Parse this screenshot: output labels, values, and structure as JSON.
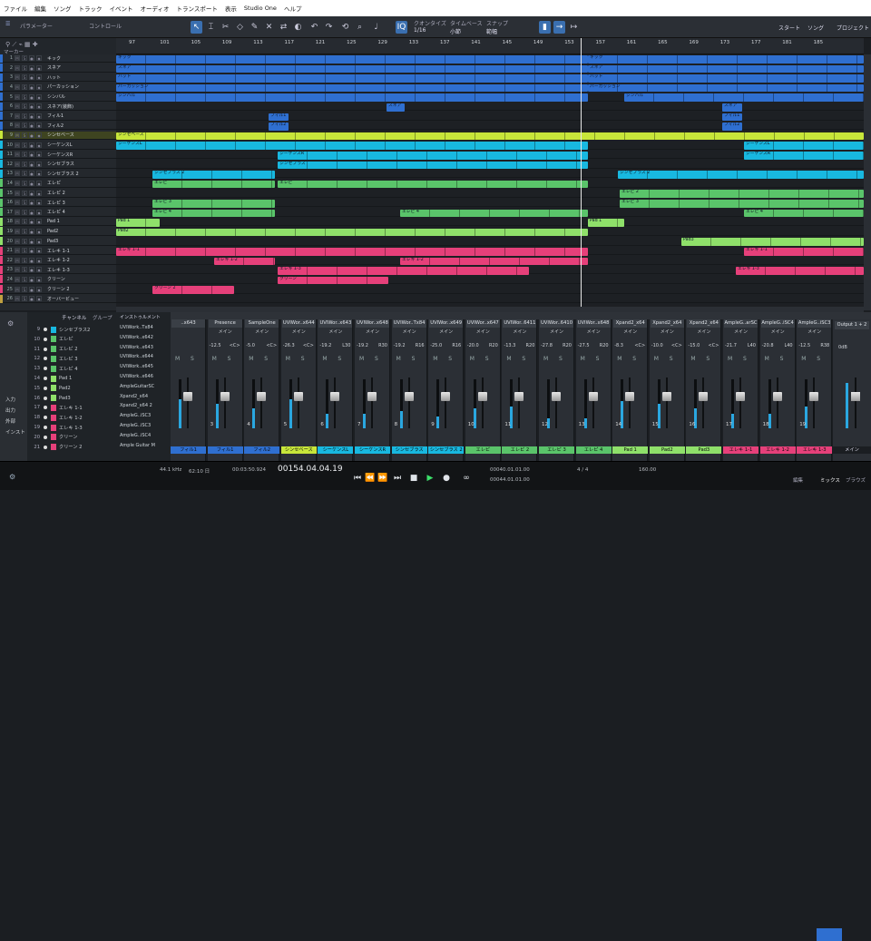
{
  "menu": [
    "ファイル",
    "編集",
    "ソング",
    "トラック",
    "イベント",
    "オーディオ",
    "トランスポート",
    "表示",
    "Studio One",
    "ヘルプ"
  ],
  "toolbar": {
    "param_label": "パラメーター",
    "control_label": "コントロール",
    "quantize_label": "クオンタイズ",
    "quantize_value": "1/16",
    "timebase_label": "タイムベース",
    "timebase_value": "小節",
    "snap_label": "スナップ",
    "snap_value": "範幅",
    "start_label": "スタート",
    "song_label": "ソング",
    "project_label": "プロジェクト"
  },
  "ruler": {
    "bars": [
      "97",
      "101",
      "105",
      "109",
      "113",
      "117",
      "121",
      "125",
      "129",
      "133",
      "137",
      "141",
      "145",
      "149",
      "153",
      "157",
      "161",
      "165",
      "169",
      "173",
      "177",
      "181",
      "185"
    ]
  },
  "marker_label": "マーカー",
  "tracks": [
    {
      "n": "1",
      "name": "キック",
      "color": "#2f6fd0"
    },
    {
      "n": "2",
      "name": "スネア",
      "color": "#2f6fd0"
    },
    {
      "n": "3",
      "name": "ハット",
      "color": "#2f6fd0"
    },
    {
      "n": "4",
      "name": "パーカッション",
      "color": "#2f6fd0"
    },
    {
      "n": "5",
      "name": "シンバル",
      "color": "#2f6fd0"
    },
    {
      "n": "6",
      "name": "スネア(装飾)",
      "color": "#2f6fd0"
    },
    {
      "n": "7",
      "name": "フィル1",
      "color": "#2f6fd0"
    },
    {
      "n": "8",
      "name": "フィル2",
      "color": "#2f6fd0"
    },
    {
      "n": "9",
      "name": "シンセベース",
      "color": "#c8e63a"
    },
    {
      "n": "10",
      "name": "シーケンスL",
      "color": "#18b8e0"
    },
    {
      "n": "11",
      "name": "シーケンスR",
      "color": "#18b8e0"
    },
    {
      "n": "12",
      "name": "シンセブラス",
      "color": "#18b8e0"
    },
    {
      "n": "13",
      "name": "シンセブラス 2",
      "color": "#18b8e0"
    },
    {
      "n": "14",
      "name": "エレピ",
      "color": "#5ac46a"
    },
    {
      "n": "15",
      "name": "エレピ 2",
      "color": "#5ac46a"
    },
    {
      "n": "16",
      "name": "エレピ 3",
      "color": "#5ac46a"
    },
    {
      "n": "17",
      "name": "エレピ 4",
      "color": "#5ac46a"
    },
    {
      "n": "18",
      "name": "Pad 1",
      "color": "#8fe06a"
    },
    {
      "n": "19",
      "name": "Pad2",
      "color": "#8fe06a"
    },
    {
      "n": "20",
      "name": "Pad3",
      "color": "#8fe06a"
    },
    {
      "n": "21",
      "name": "エレキ 1-1",
      "color": "#e6407a"
    },
    {
      "n": "22",
      "name": "エレキ 1-2",
      "color": "#e6407a"
    },
    {
      "n": "23",
      "name": "エレキ 1-3",
      "color": "#e6407a"
    },
    {
      "n": "24",
      "name": "クリーン",
      "color": "#e6407a"
    },
    {
      "n": "25",
      "name": "クリーン 2",
      "color": "#e6407a"
    },
    {
      "n": "26",
      "name": "オーバービュー",
      "color": "#c0a040"
    }
  ],
  "clips": [
    {
      "lane": 0,
      "label": "キック",
      "segs": [
        [
          0,
          520
        ],
        [
          520,
          824
        ]
      ]
    },
    {
      "lane": 1,
      "label": "スネア",
      "segs": [
        [
          0,
          520
        ],
        [
          520,
          824
        ]
      ]
    },
    {
      "lane": 2,
      "label": "ハット",
      "segs": [
        [
          0,
          520
        ],
        [
          520,
          824
        ]
      ]
    },
    {
      "lane": 3,
      "label": "パーカッション",
      "segs": [
        [
          0,
          520
        ],
        [
          520,
          824
        ]
      ]
    },
    {
      "lane": 4,
      "label": "シンバル",
      "segs": [
        [
          0,
          520
        ],
        [
          560,
          824
        ]
      ]
    },
    {
      "lane": 5,
      "label": "スネア",
      "segs": [
        [
          298,
          318
        ],
        [
          668,
          690
        ]
      ]
    },
    {
      "lane": 6,
      "label": "フィル1",
      "segs": [
        [
          168,
          190
        ],
        [
          668,
          690
        ]
      ]
    },
    {
      "lane": 7,
      "label": "フィル2",
      "segs": [
        [
          168,
          190
        ],
        [
          668,
          690
        ]
      ]
    },
    {
      "lane": 8,
      "label": "シンセベース",
      "segs": [
        [
          0,
          824
        ]
      ]
    },
    {
      "lane": 9,
      "label": "シーケンスL",
      "segs": [
        [
          0,
          520
        ],
        [
          692,
          824
        ]
      ]
    },
    {
      "lane": 10,
      "label": "シーケンスR",
      "segs": [
        [
          178,
          520
        ],
        [
          692,
          824
        ]
      ]
    },
    {
      "lane": 11,
      "label": "シンセブラス",
      "segs": [
        [
          178,
          520
        ]
      ]
    },
    {
      "lane": 12,
      "label": "シンセブラス 2",
      "segs": [
        [
          40,
          175
        ],
        [
          553,
          824
        ]
      ]
    },
    {
      "lane": 13,
      "label": "エレピ",
      "segs": [
        [
          40,
          175
        ],
        [
          178,
          520
        ]
      ]
    },
    {
      "lane": 14,
      "label": "エレピ 2",
      "segs": [
        [
          555,
          824
        ]
      ]
    },
    {
      "lane": 15,
      "label": "エレピ 3",
      "segs": [
        [
          40,
          175
        ],
        [
          555,
          824
        ]
      ]
    },
    {
      "lane": 16,
      "label": "エレピ 4",
      "segs": [
        [
          40,
          175
        ],
        [
          313,
          520
        ],
        [
          692,
          824
        ]
      ]
    },
    {
      "lane": 17,
      "label": "Pad 1",
      "segs": [
        [
          0,
          48
        ],
        [
          520,
          560
        ]
      ]
    },
    {
      "lane": 18,
      "label": "Pad2",
      "segs": [
        [
          0,
          520
        ]
      ]
    },
    {
      "lane": 19,
      "label": "Pad3",
      "segs": [
        [
          623,
          824
        ]
      ]
    },
    {
      "lane": 20,
      "label": "エレキ 1-1",
      "segs": [
        [
          0,
          520
        ],
        [
          692,
          824
        ]
      ]
    },
    {
      "lane": 21,
      "label": "エレキ 1-2",
      "segs": [
        [
          108,
          175
        ],
        [
          313,
          520
        ]
      ]
    },
    {
      "lane": 22,
      "label": "エレキ 1-3",
      "segs": [
        [
          178,
          455
        ],
        [
          683,
          824
        ]
      ]
    },
    {
      "lane": 23,
      "label": "クリーン",
      "segs": [
        [
          178,
          300
        ]
      ]
    },
    {
      "lane": 24,
      "label": "クリーン 2",
      "segs": [
        [
          40,
          130
        ]
      ]
    }
  ],
  "mixer": {
    "tab_channel": "チャンネル",
    "tab_group": "グループ",
    "tab_inst": "インストゥルメント",
    "side": [
      "入力",
      "出力",
      "外部",
      "インスト"
    ],
    "chan_list": [
      {
        "n": "9",
        "name": "シンセブラス2",
        "c": "#18b8e0"
      },
      {
        "n": "10",
        "name": "エレピ",
        "c": "#5ac46a"
      },
      {
        "n": "11",
        "name": "エレピ 2",
        "c": "#5ac46a"
      },
      {
        "n": "12",
        "name": "エレピ 3",
        "c": "#5ac46a"
      },
      {
        "n": "13",
        "name": "エレピ 4",
        "c": "#5ac46a"
      },
      {
        "n": "14",
        "name": "Pad 1",
        "c": "#8fe06a"
      },
      {
        "n": "15",
        "name": "Pad2",
        "c": "#8fe06a"
      },
      {
        "n": "16",
        "name": "Pad3",
        "c": "#8fe06a"
      },
      {
        "n": "17",
        "name": "エレキ 1-1",
        "c": "#e6407a"
      },
      {
        "n": "18",
        "name": "エレキ 1-2",
        "c": "#e6407a"
      },
      {
        "n": "19",
        "name": "エレキ 1-3",
        "c": "#e6407a"
      },
      {
        "n": "20",
        "name": "クリーン",
        "c": "#e6407a"
      },
      {
        "n": "21",
        "name": "クリーン 2",
        "c": "#e6407a"
      }
    ],
    "inst_list": [
      "UVIWork..Tx84",
      "UVIWork..x642",
      "UVIWork..x643",
      "UVIWork..x644",
      "UVIWork..x645",
      "UVIWork..x646",
      "AmpleGuitarSC",
      "Xpand2_x64",
      "Xpand2_x64 2",
      "AmpleG..iSC3",
      "AmpleG..iSC3",
      "AmpleG..iSC4",
      "Ample Guitar M"
    ],
    "strips": [
      {
        "name": "..x643",
        "out": "",
        "vol": "",
        "pan": "",
        "ck": "フィル1",
        "c": "#2f6fd0",
        "idx": "",
        "m": 0.6
      },
      {
        "name": "Presence",
        "out": "メイン",
        "vol": "-12.5",
        "pan": "<C>",
        "ck": "フィル1",
        "c": "#2f6fd0",
        "idx": "3",
        "m": 0.5
      },
      {
        "name": "SampleOne",
        "out": "メイン",
        "vol": "-5.0",
        "pan": "<C>",
        "ck": "フィル2",
        "c": "#2f6fd0",
        "idx": "4",
        "m": 0.4
      },
      {
        "name": "UVIWor..x644",
        "out": "メイン",
        "vol": "-26.3",
        "pan": "<C>",
        "ck": "シンセベース",
        "c": "#c8e63a",
        "idx": "5",
        "m": 0.6
      },
      {
        "name": "UVIWor..x643",
        "out": "メイン",
        "vol": "-19.2",
        "pan": "L30",
        "ck": "シーケンスL",
        "c": "#18b8e0",
        "idx": "6",
        "m": 0.3
      },
      {
        "name": "UVIWor..x648",
        "out": "メイン",
        "vol": "-19.2",
        "pan": "R30",
        "ck": "シーケンスR",
        "c": "#18b8e0",
        "idx": "7",
        "m": 0.3
      },
      {
        "name": "UVIWor..Tx84",
        "out": "メイン",
        "vol": "-19.2",
        "pan": "R16",
        "ck": "シンセブラス",
        "c": "#18b8e0",
        "idx": "8",
        "m": 0.35
      },
      {
        "name": "UVIWor..x649",
        "out": "メイン",
        "vol": "-25.0",
        "pan": "R16",
        "ck": "シンセブラス 2",
        "c": "#18b8e0",
        "idx": "9",
        "m": 0.25
      },
      {
        "name": "UVIWor..x647",
        "out": "メイン",
        "vol": "-20.0",
        "pan": "R20",
        "ck": "エレピ",
        "c": "#5ac46a",
        "idx": "10",
        "m": 0.4
      },
      {
        "name": "UVIWor..6411",
        "out": "メイン",
        "vol": "-13.3",
        "pan": "R20",
        "ck": "エレピ 2",
        "c": "#5ac46a",
        "idx": "11",
        "m": 0.45
      },
      {
        "name": "UVIWor..6410",
        "out": "メイン",
        "vol": "-27.8",
        "pan": "R20",
        "ck": "エレピ 3",
        "c": "#5ac46a",
        "idx": "12",
        "m": 0.2
      },
      {
        "name": "UVIWor..x648",
        "out": "メイン",
        "vol": "-27.5",
        "pan": "R20",
        "ck": "エレピ 4",
        "c": "#5ac46a",
        "idx": "13",
        "m": 0.2
      },
      {
        "name": "Xpand2_x64",
        "out": "メイン",
        "vol": "-8.3",
        "pan": "<C>",
        "ck": "Pad 1",
        "c": "#8fe06a",
        "idx": "14",
        "m": 0.55
      },
      {
        "name": "Xpand2_x64",
        "out": "メイン",
        "vol": "-10.0",
        "pan": "<C>",
        "ck": "Pad2",
        "c": "#8fe06a",
        "idx": "15",
        "m": 0.5
      },
      {
        "name": "Xpand2_x64",
        "out": "メイン",
        "vol": "-15.0",
        "pan": "<C>",
        "ck": "Pad3",
        "c": "#8fe06a",
        "idx": "16",
        "m": 0.4
      },
      {
        "name": "AmpleG..arSC",
        "out": "メイン",
        "vol": "-21.7",
        "pan": "L40",
        "ck": "エレキ 1-1",
        "c": "#e6407a",
        "idx": "17",
        "m": 0.3
      },
      {
        "name": "AmpleG..iSC4",
        "out": "メイン",
        "vol": "-20.8",
        "pan": "L40",
        "ck": "エレキ 1-2",
        "c": "#e6407a",
        "idx": "18",
        "m": 0.3
      },
      {
        "name": "AmpleG..iSC3",
        "out": "メイン",
        "vol": "-12.5",
        "pan": "R38",
        "ck": "エレキ 1-3",
        "c": "#e6407a",
        "idx": "19",
        "m": 0.45
      }
    ],
    "main_out": {
      "name": "Output 1 + 2",
      "vol": "0dB",
      "ck": "メイン"
    }
  },
  "transport": {
    "sample_rate": "44.1 kHz",
    "record_time": "62:10 日",
    "time": "00:03:50.924",
    "position": "00154.04.04.19",
    "loop_start": "00040.01.01.00",
    "loop_end": "00044.01.01.00",
    "signature": "4 / 4",
    "tempo": "160.00",
    "edit": "編集",
    "mix": "ミックス",
    "browse": "ブラウズ"
  }
}
